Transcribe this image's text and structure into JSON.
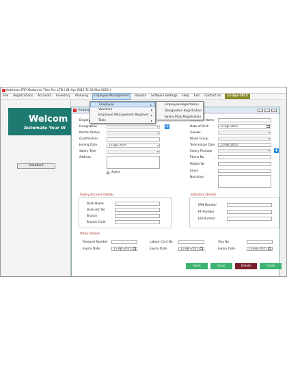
{
  "app": {
    "title": "Automan ERP Madonnie Tiles Pvt. LTD ( 01-Apr-2015 To 31-Mar-2016 )"
  },
  "menubar": {
    "items": [
      "File",
      "Registrations",
      "Accounts",
      "Inventory",
      "Planning",
      "Employee Management",
      "Reports",
      "Software Settings",
      "Help",
      "Exit",
      "Contact Us"
    ],
    "financial_year": "11-Apr-2015"
  },
  "welcome": {
    "title": "Welcom",
    "subtitle": "Automate Your W"
  },
  "sidebar": {
    "dashboard": "DashBord"
  },
  "form": {
    "title": "Employee",
    "left_labels": {
      "employee": "Employee",
      "designation": "Designation",
      "marital": "Marital Status",
      "qualification": "Qualification",
      "joining": "Joining Date",
      "salary_type": "Salary Type",
      "address": "Address"
    },
    "joining_date": "11-Apr-2015",
    "active": "Active",
    "right_labels": {
      "name": "Employee Name",
      "dob": "Date of Birth",
      "gender": "Gender",
      "blood": "Blood Group",
      "termination": "Termination Date",
      "salary_package": "Salary Package",
      "phone": "Phone No",
      "mobile": "Mobile No",
      "email": "Email",
      "narration": "Narration"
    },
    "dob": "11-Apr-2015",
    "termination_date": "11-Apr-2015",
    "salary_section": {
      "title": "Salary Account Details",
      "bank_name": "Bank Name",
      "bank_ac": "Bank A/C No",
      "branch": "Branch",
      "branch_code": "Branch Code"
    },
    "statutory_section": {
      "title": "Statutory Details",
      "pan": "PAN Number",
      "pf": "PF Number",
      "esi": "ESI Number"
    },
    "other_section": {
      "title": "Other Details",
      "passport": "Passport Number",
      "labour": "Labour Card No.",
      "visa": "Visa No.",
      "expiry": "Expiry Date",
      "expiry_value": "11-Apr-2015"
    },
    "buttons": {
      "save": "Save",
      "clear": "Clear",
      "delete": "Delete",
      "close": "Close"
    }
  },
  "menu": {
    "level1": [
      "Employee",
      "Vouchers",
      "Employee Management Registers",
      "Tools"
    ],
    "level2": [
      "Employee Registration",
      "Designation Registration",
      "Salary Pack Registration"
    ]
  },
  "colors": {
    "teal": "#1e7a70",
    "green": "#3cb371",
    "delete": "#7a1e2a",
    "accent": "#1e88e5"
  }
}
